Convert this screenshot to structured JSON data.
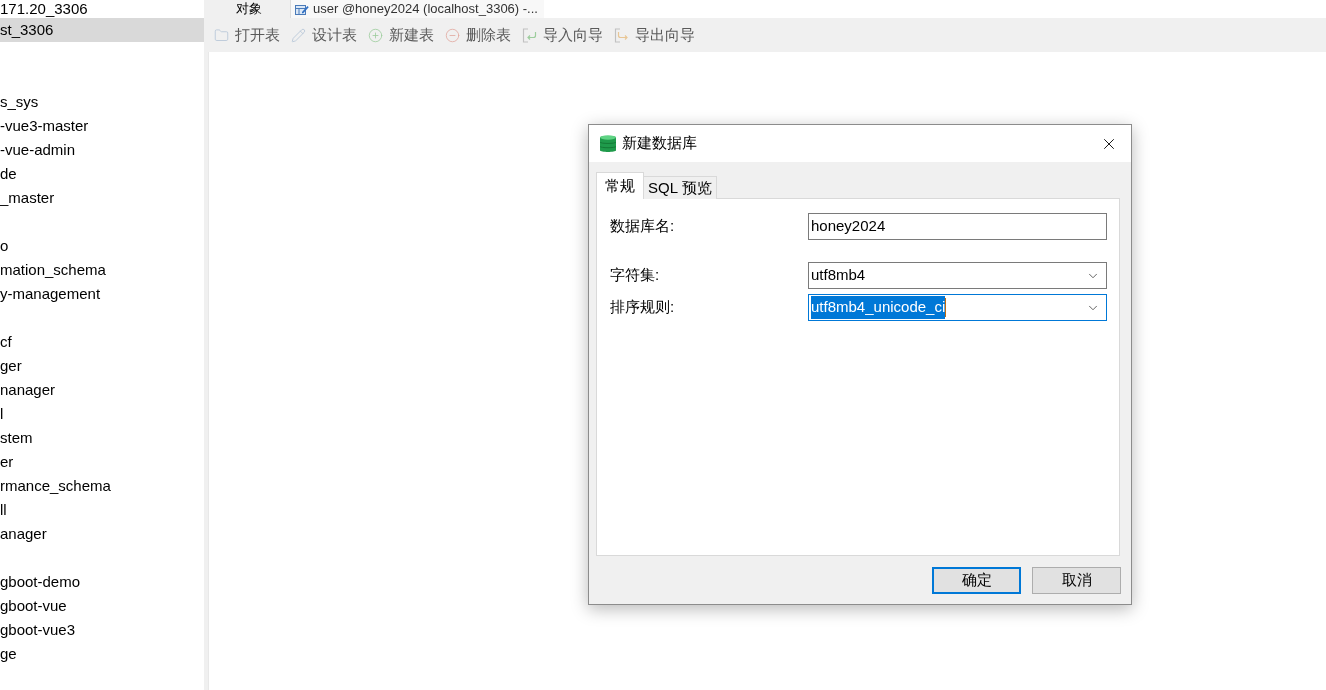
{
  "sidebar": {
    "items": [
      {
        "kind": "row",
        "label": "171.20_3306",
        "selected": false
      },
      {
        "kind": "row",
        "label": "st_3306",
        "selected": true
      },
      {
        "kind": "blank"
      },
      {
        "kind": "blank"
      },
      {
        "kind": "row",
        "label": "s_sys",
        "selected": false
      },
      {
        "kind": "row",
        "label": "-vue3-master",
        "selected": false
      },
      {
        "kind": "row",
        "label": "-vue-admin",
        "selected": false
      },
      {
        "kind": "row",
        "label": "de",
        "selected": false
      },
      {
        "kind": "row",
        "label": "_master",
        "selected": false
      },
      {
        "kind": "blank"
      },
      {
        "kind": "row",
        "label": "o",
        "selected": false
      },
      {
        "kind": "row",
        "label": "mation_schema",
        "selected": false
      },
      {
        "kind": "row",
        "label": "y-management",
        "selected": false
      },
      {
        "kind": "blank"
      },
      {
        "kind": "row",
        "label": "cf",
        "selected": false
      },
      {
        "kind": "row",
        "label": "ger",
        "selected": false
      },
      {
        "kind": "row",
        "label": "nanager",
        "selected": false
      },
      {
        "kind": "row",
        "label": "l",
        "selected": false
      },
      {
        "kind": "row",
        "label": "stem",
        "selected": false
      },
      {
        "kind": "row",
        "label": "er",
        "selected": false
      },
      {
        "kind": "row",
        "label": "rmance_schema",
        "selected": false
      },
      {
        "kind": "row",
        "label": "ll",
        "selected": false
      },
      {
        "kind": "row",
        "label": "anager",
        "selected": false
      },
      {
        "kind": "blank"
      },
      {
        "kind": "row",
        "label": "gboot-demo",
        "selected": false
      },
      {
        "kind": "row",
        "label": "gboot-vue",
        "selected": false
      },
      {
        "kind": "row",
        "label": "gboot-vue3",
        "selected": false
      },
      {
        "kind": "row",
        "label": "ge",
        "selected": false
      }
    ]
  },
  "tabs": [
    {
      "kind": "objects",
      "label": "对象",
      "selected": true
    },
    {
      "kind": "table",
      "label": "user @honey2024 (localhost_3306) -...",
      "selected": false
    }
  ],
  "toolbar": {
    "items": [
      {
        "kind": "open",
        "label": "打开表",
        "disabled": true
      },
      {
        "kind": "design",
        "label": "设计表",
        "disabled": true
      },
      {
        "kind": "new",
        "label": "新建表",
        "disabled": true
      },
      {
        "kind": "delete",
        "label": "删除表",
        "disabled": true
      },
      {
        "kind": "import",
        "label": "导入向导",
        "disabled": true
      },
      {
        "kind": "export",
        "label": "导出向导",
        "disabled": true
      }
    ]
  },
  "dialog": {
    "title": "新建数据库",
    "tabs": [
      {
        "label": "常规",
        "selected": true
      },
      {
        "label": "SQL 预览",
        "selected": false
      }
    ],
    "fields": [
      {
        "kind": "text",
        "label": "数据库名:",
        "value": "honey2024",
        "focused": false
      },
      {
        "kind": "select",
        "label": "字符集:",
        "value": "utf8mb4",
        "focused": false
      },
      {
        "kind": "select",
        "label": "排序规则:",
        "value": "utf8mb4_unicode_ci",
        "focused": true
      }
    ],
    "buttons": [
      {
        "label": "确定",
        "default": true
      },
      {
        "label": "取消",
        "default": false
      }
    ]
  }
}
